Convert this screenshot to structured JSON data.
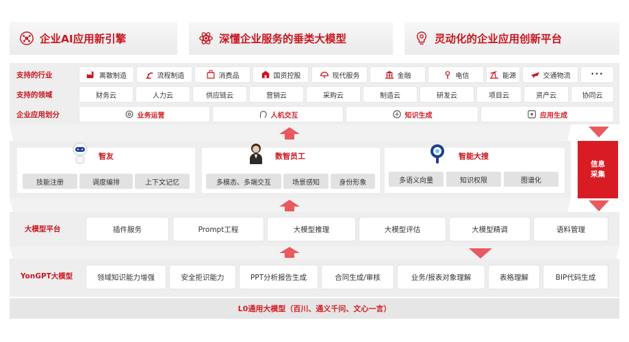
{
  "header": {
    "banners": [
      {
        "label": "企业AI应用新引擎",
        "icon": "ai-network-icon"
      },
      {
        "label": "深懂企业服务的垂类大模型",
        "icon": "atom-icon"
      },
      {
        "label": "灵动化的企业应用创新平台",
        "icon": "lightbulb-gear-icon"
      }
    ]
  },
  "top_section": {
    "industries_label": "支持的行业",
    "industries": [
      {
        "label": "离散制造",
        "icon": "factory-icon"
      },
      {
        "label": "流程制造",
        "icon": "robot-arm-icon"
      },
      {
        "label": "消费品",
        "icon": "shopping-bag-icon"
      },
      {
        "label": "国资控股",
        "icon": "building-icon"
      },
      {
        "label": "现代服务",
        "icon": "service-icon"
      },
      {
        "label": "金融",
        "icon": "bank-icon"
      },
      {
        "label": "电信",
        "icon": "signal-tower-icon"
      },
      {
        "label": "能源",
        "icon": "oil-pump-icon"
      },
      {
        "label": "交通物流",
        "icon": "airplane-icon"
      },
      {
        "label": "•••",
        "icon": "more-icon"
      }
    ],
    "domains_label": "支持的领域",
    "domains": [
      "财务云",
      "人力云",
      "供应链云",
      "营销云",
      "采购云",
      "制造云",
      "研发云",
      "项目云",
      "资产云",
      "协同云"
    ],
    "app_division_label": "企业应用划分",
    "app_divisions": [
      {
        "label": "业务运营",
        "icon": "gears-icon"
      },
      {
        "label": "人机交互",
        "icon": "head-chat-icon"
      },
      {
        "label": "知识生成",
        "icon": "brain-icon"
      },
      {
        "label": "应用生成",
        "icon": "app-gear-icon"
      }
    ]
  },
  "assistants": {
    "cards": [
      {
        "title": "智友",
        "avatar": "robot-avatar-icon",
        "features": [
          "技能注册",
          "调度编排",
          "上下文记忆"
        ]
      },
      {
        "title": "数智员工",
        "avatar": "digital-employee-avatar-icon",
        "features": [
          "多模态、多端交互",
          "场景感知",
          "身份形象"
        ]
      },
      {
        "title": "智能大搜",
        "avatar": "search-lens-avatar-icon",
        "features": [
          "多语义向量",
          "知识权限",
          "图谱化"
        ]
      }
    ],
    "info_box": [
      "信息",
      "采集"
    ]
  },
  "platform": {
    "label": "大模型平台",
    "items": [
      "插件服务",
      "Prompt工程",
      "大模型推理",
      "大模型评估",
      "大模型精调",
      "语料管理"
    ]
  },
  "yongpt": {
    "label": "YonGPT大模型",
    "items": [
      "领域知识能力增强",
      "安全拒识能力",
      "PPT分析报告生成",
      "合同生成/审核",
      "业务/报表对象理解",
      "表格理解",
      "BIP代码生成"
    ]
  },
  "base_model": {
    "label": "L0通用大模型（百川、通义千问、文心一言）"
  },
  "colors": {
    "accent": "#c8161e",
    "arrow": "#e85a5f",
    "panel": "#eeeeee",
    "info_box": "#d91c24"
  }
}
